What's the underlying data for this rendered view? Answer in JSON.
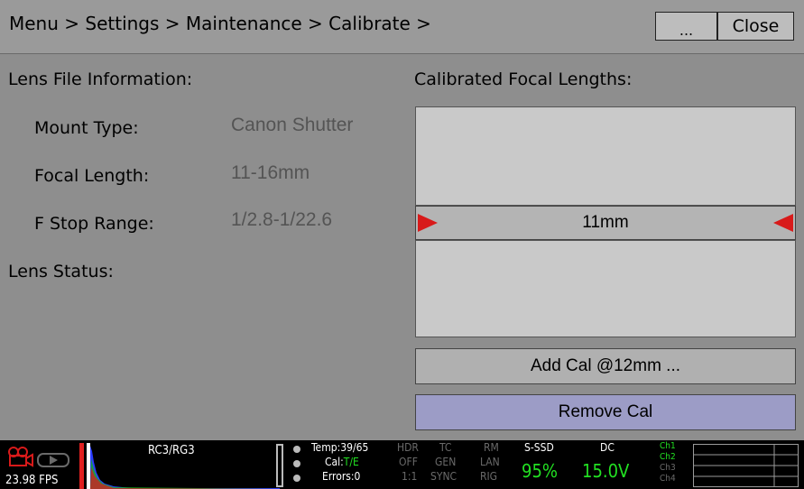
{
  "header": {
    "breadcrumb": "Menu > Settings > Maintenance > Calibrate >",
    "more_label": "...",
    "close_label": "Close"
  },
  "lens_info": {
    "title": "Lens File Information:",
    "rows": [
      {
        "label": "Mount Type:",
        "value": "Canon Shutter"
      },
      {
        "label": "Focal Length:",
        "value": "11-16mm"
      },
      {
        "label": "F Stop Range:",
        "value": "1/2.8-1/22.6"
      }
    ],
    "status_title": "Lens Status:"
  },
  "focal": {
    "title": "Calibrated Focal Lengths:",
    "selected": "11mm",
    "add_label": "Add Cal @12mm ...",
    "remove_label": "Remove Cal"
  },
  "statusbar": {
    "fps": "23.98 FPS",
    "look": "RC3/RG3",
    "temp": "Temp:39/65",
    "cal_prefix": "Cal:",
    "cal_value": "T/E",
    "errors": "Errors:0",
    "hdr": [
      "HDR",
      "OFF",
      "1:1"
    ],
    "tc": [
      "TC",
      "GEN",
      "SYNC"
    ],
    "rm": [
      "RM",
      "LAN",
      "RIG"
    ],
    "media_label": "S-SSD",
    "media_value": "95%",
    "power_label": "DC",
    "power_value": "15.0V",
    "channels": [
      "Ch1",
      "Ch2",
      "Ch3",
      "Ch4"
    ]
  },
  "colors": {
    "accent_red": "#d81a1a",
    "active_green": "#22e022",
    "dim_gray": "#6a6a6a",
    "remove_button": "#9c9cc6"
  }
}
